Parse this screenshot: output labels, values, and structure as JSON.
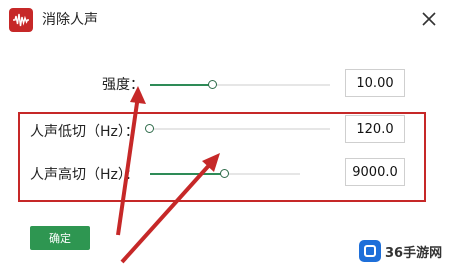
{
  "window": {
    "title": "消除人声"
  },
  "controls": [
    {
      "label": "强度：",
      "value": "10.00",
      "level": 0.35
    },
    {
      "label": "人声低切（Hz）：",
      "value": "120.0",
      "level": 0.0
    },
    {
      "label": "人声高切（Hz）：",
      "value": "9000.0",
      "level": 0.5
    }
  ],
  "buttons": {
    "ok": "确定"
  },
  "watermark": {
    "text": "36手游网"
  },
  "colors": {
    "accent": "#2e9651",
    "annotation": "#c62828"
  }
}
